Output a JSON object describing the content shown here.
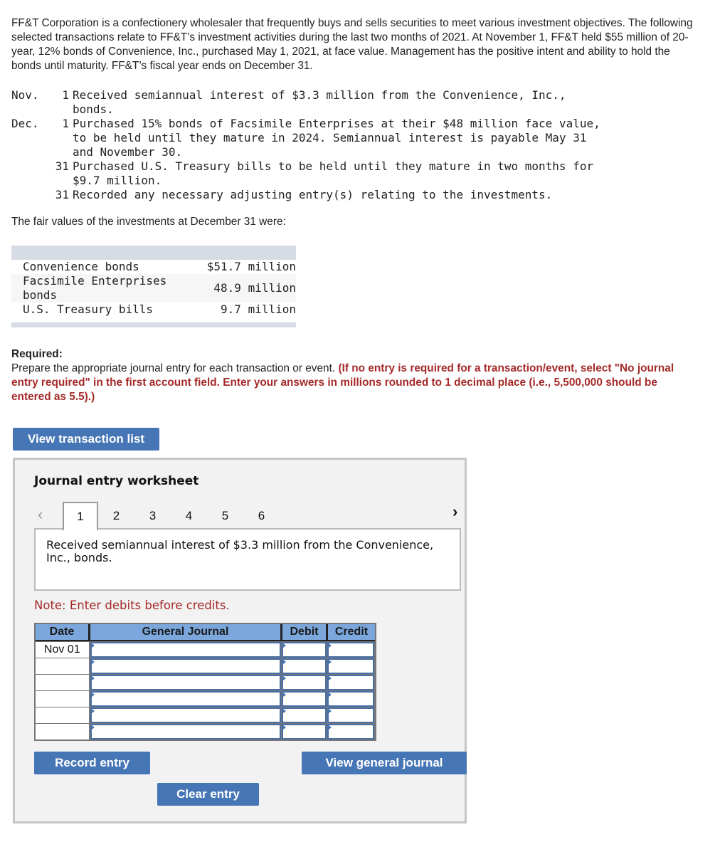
{
  "intro": {
    "text": "FF&T Corporation is a confectionery wholesaler that frequently buys and sells securities to meet various investment objectives. The following selected transactions relate to FF&T’s investment activities during the last two months of 2021. At November 1, FF&T held $55 million of 20-year, 12% bonds of Convenience, Inc., purchased May 1, 2021, at face value. Management has the positive intent and ability to hold the bonds until maturity. FF&T’s fiscal year ends on December 31."
  },
  "transactions": [
    {
      "month": "Nov.",
      "day": "1",
      "lines": [
        "Received semiannual interest of $3.3 million from the Convenience, Inc.,",
        "bonds."
      ]
    },
    {
      "month": "Dec.",
      "day": "1",
      "lines": [
        "Purchased 15% bonds of Facsimile Enterprises at their $48 million face value,",
        "to be held until they mature in 2024. Semiannual interest is payable May 31",
        "and November 30."
      ]
    },
    {
      "month": "",
      "day": "31",
      "lines": [
        "Purchased U.S. Treasury bills to be held until they mature in two months for",
        "$9.7 million."
      ]
    },
    {
      "month": "",
      "day": "31",
      "lines": [
        "Recorded any necessary adjusting entry(s) relating to the investments."
      ]
    }
  ],
  "fair_values": {
    "intro": "The fair values of the investments at December 31 were:",
    "rows": [
      {
        "name": "Convenience bonds",
        "value": "$51.7 million"
      },
      {
        "name": "Facsimile Enterprises bonds",
        "value": "48.9 million"
      },
      {
        "name": "U.S. Treasury bills",
        "value": "9.7 million"
      }
    ]
  },
  "required": {
    "title": "Required:",
    "text": "Prepare the appropriate journal entry for each transaction or event.",
    "instruction": "(If no entry is required for a transaction/event, select \"No journal entry required\" in the first account field. Enter your answers in millions rounded to 1 decimal place (i.e., 5,500,000 should be entered as 5.5).)"
  },
  "buttons": {
    "view_transaction_list": "View transaction list",
    "record_entry": "Record entry",
    "clear_entry": "Clear entry",
    "view_general_journal": "View general journal"
  },
  "worksheet": {
    "title": "Journal entry worksheet",
    "tabs": [
      "1",
      "2",
      "3",
      "4",
      "5",
      "6"
    ],
    "active_tab": "1",
    "prev_icon": "‹",
    "next_icon": "›",
    "description": "Received semiannual interest of $3.3 million from the Convenience, Inc., bonds.",
    "note": "Note: Enter debits before credits.",
    "columns": [
      "Date",
      "General Journal",
      "Debit",
      "Credit"
    ],
    "rows": [
      {
        "date": "Nov 01",
        "account": "",
        "debit": "",
        "credit": ""
      },
      {
        "date": "",
        "account": "",
        "debit": "",
        "credit": ""
      },
      {
        "date": "",
        "account": "",
        "debit": "",
        "credit": ""
      },
      {
        "date": "",
        "account": "",
        "debit": "",
        "credit": ""
      },
      {
        "date": "",
        "account": "",
        "debit": "",
        "credit": ""
      },
      {
        "date": "",
        "account": "",
        "debit": "",
        "credit": ""
      }
    ]
  },
  "colors": {
    "button_blue": "#4676b5",
    "header_blue": "#7ba7dd",
    "alert_red": "#a52a2a"
  }
}
